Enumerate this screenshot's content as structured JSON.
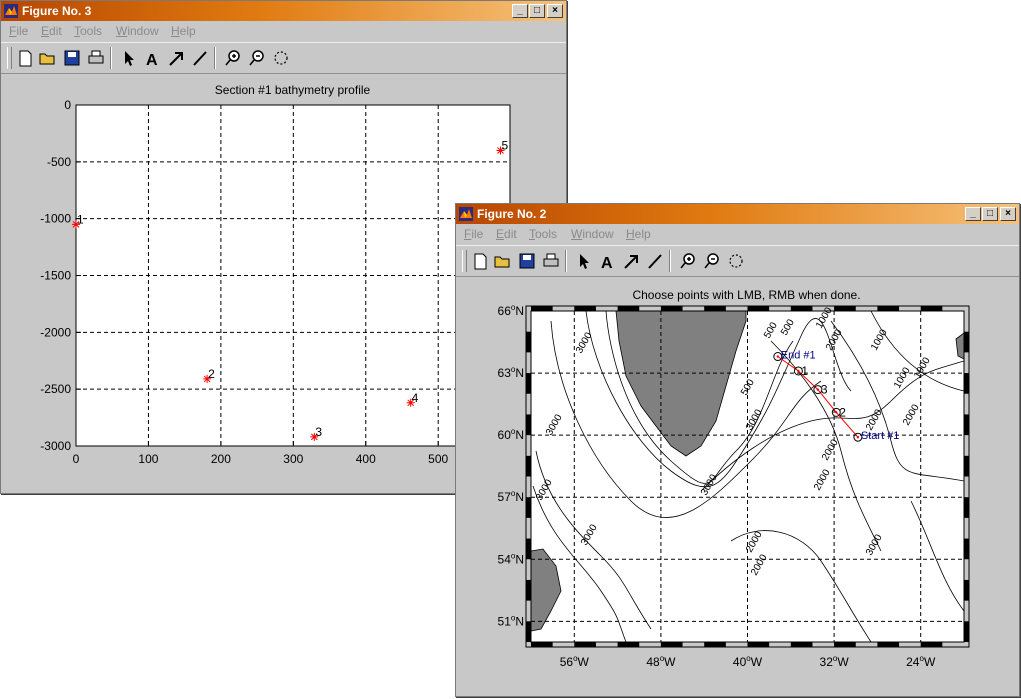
{
  "menu_items": [
    "File",
    "Edit",
    "Tools",
    "Window",
    "Help"
  ],
  "menu_mnemonics": [
    "F",
    "E",
    "T",
    "W",
    "H"
  ],
  "toolbar_icons": [
    "new-icon",
    "open-icon",
    "save-icon",
    "print-icon",
    "arrow-select-icon",
    "text-icon",
    "draw-arrow-icon",
    "draw-line-icon",
    "zoom-in-icon",
    "zoom-out-icon",
    "rotate-icon"
  ],
  "figure3": {
    "title": "Figure No. 3",
    "plot_title": "Section #1 bathymetry profile"
  },
  "figure2": {
    "title": "Figure No. 2",
    "plot_title": "Choose points with LMB, RMB when done.",
    "section_start_label": "Start #1",
    "section_end_label": "End #1",
    "waypoint_labels": [
      "1",
      "2",
      "3",
      "4",
      "5"
    ],
    "contour_labels": [
      "500",
      "1000",
      "1000",
      "1000",
      "2000",
      "2000",
      "2000",
      "2000",
      "2000",
      "2000",
      "2000",
      "3000",
      "3000",
      "3000",
      "3000",
      "3000",
      "3000",
      "3000",
      "500",
      "500",
      "1000"
    ]
  },
  "chart_data": [
    {
      "type": "scatter",
      "title": "Section #1 bathymetry profile",
      "xlim": [
        0,
        600
      ],
      "ylim": [
        -3000,
        0
      ],
      "xticks": [
        0,
        100,
        200,
        300,
        400,
        500
      ],
      "yticks": [
        0,
        -500,
        -1000,
        -1500,
        -2000,
        -2500,
        -3000
      ],
      "grid": true,
      "marker_color": "#ff0000",
      "points": [
        {
          "label": "1",
          "x": 0,
          "y": -1050
        },
        {
          "label": "2",
          "x": 181,
          "y": -2410
        },
        {
          "label": "3",
          "x": 329,
          "y": -2920
        },
        {
          "label": "4",
          "x": 462,
          "y": -2620
        },
        {
          "label": "5",
          "x": 586,
          "y": -400
        }
      ]
    },
    {
      "type": "map",
      "title": "Choose points with LMB, RMB when done.",
      "lon_range": [
        -60,
        -20
      ],
      "lat_range": [
        50,
        66
      ],
      "lon_ticks": [
        "56°W",
        "48°W",
        "40°W",
        "32°W",
        "24°W"
      ],
      "lat_ticks": [
        "66°N",
        "63°N",
        "60°N",
        "57°N",
        "54°N",
        "51°N"
      ],
      "grid": true,
      "land_color": "#808080",
      "section_color": "#ff0000",
      "label_color": "#00008b",
      "section_points": [
        {
          "label": "End #1",
          "lon": -37.2,
          "lat": 63.8
        },
        {
          "label": "1",
          "lon": -35.3,
          "lat": 63.1
        },
        {
          "label": "3",
          "lon": -33.5,
          "lat": 62.2
        },
        {
          "label": "2",
          "lon": -31.8,
          "lat": 61.1
        },
        {
          "label": "Start #1",
          "lon": -29.8,
          "lat": 59.9
        }
      ]
    }
  ]
}
